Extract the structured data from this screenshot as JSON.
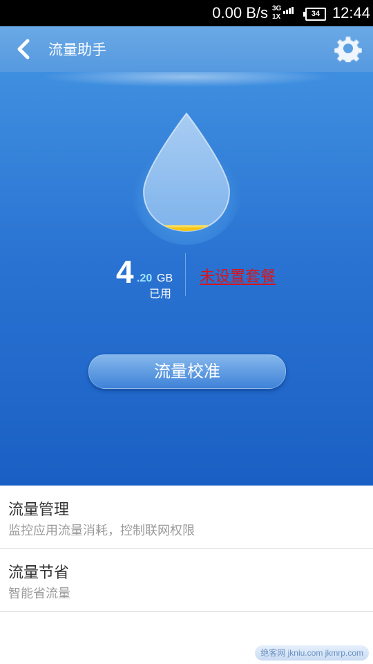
{
  "status_bar": {
    "net_speed": "0.00 B/s",
    "network_top": "3G",
    "network_bottom": "1X",
    "battery": "34",
    "time": "12:44"
  },
  "header": {
    "title": "流量助手",
    "back_icon": "back-chevron-icon",
    "settings_icon": "gear-icon"
  },
  "usage": {
    "integer": "4",
    "decimal": ".20",
    "unit": "GB",
    "label": "已用",
    "plan_link": "未设置套餐",
    "fill_fraction": 0.05
  },
  "calibrate_button": "流量校准",
  "list": [
    {
      "title": "流量管理",
      "subtitle": "监控应用流量消耗，控制联网权限"
    },
    {
      "title": "流量节省",
      "subtitle": "智能省流量"
    }
  ],
  "watermark": "绝客网 jkniu.com jkmrp.com",
  "colors": {
    "header": "#5c9fe2",
    "hero_top": "#3f8fe0",
    "hero_bottom": "#1a60c4",
    "plan_link": "#d9141b",
    "decimal_accent": "#9fe3ff",
    "water_level": "#f5c518"
  }
}
